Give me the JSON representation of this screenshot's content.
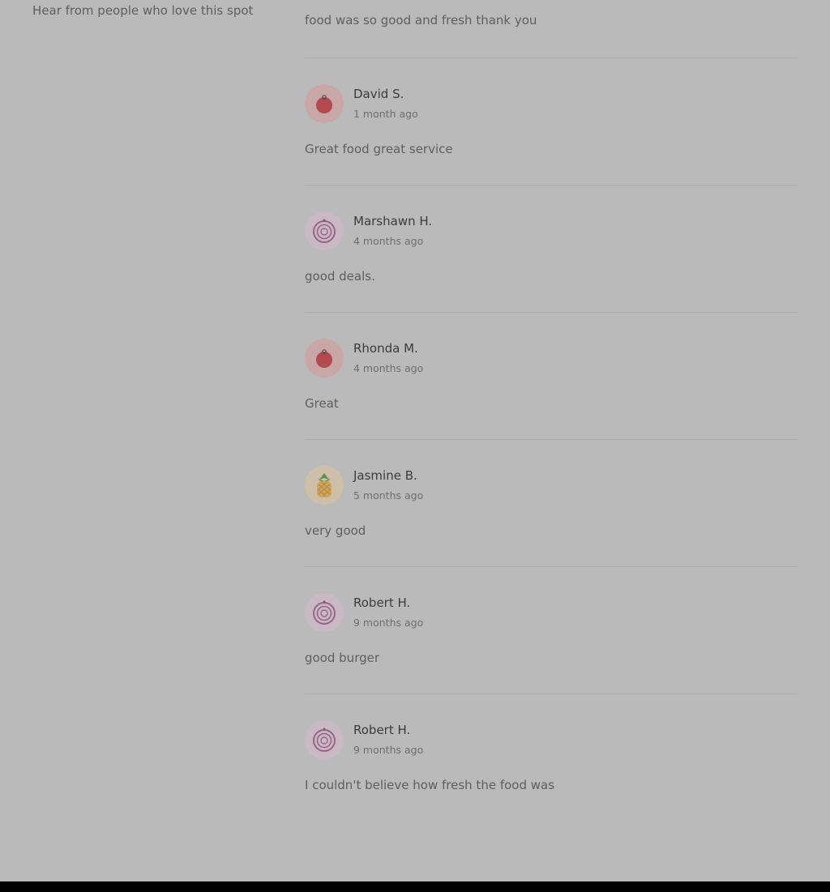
{
  "sidebar": {
    "subtitle": "Hear from people who love this spot"
  },
  "first_review": {
    "text": "food was so good and fresh thank you"
  },
  "reviews": [
    {
      "name": "David S.",
      "date": "1 month ago",
      "text": "Great food great service",
      "avatar": "tomato-icon",
      "avatar_bg": "#c9a7a7"
    },
    {
      "name": "Marshawn H.",
      "date": "4 months ago",
      "text": "good deals.",
      "avatar": "onion-icon",
      "avatar_bg": "#c8b9c4"
    },
    {
      "name": "Rhonda M.",
      "date": "4 months ago",
      "text": "Great",
      "avatar": "tomato-icon",
      "avatar_bg": "#c9a7a7"
    },
    {
      "name": "Jasmine B.",
      "date": "5 months ago",
      "text": "very good",
      "avatar": "pineapple-icon",
      "avatar_bg": "#cdbfa8"
    },
    {
      "name": "Robert H.",
      "date": "9 months ago",
      "text": "good burger",
      "avatar": "onion-icon",
      "avatar_bg": "#c8b9c4"
    },
    {
      "name": "Robert H.",
      "date": "9 months ago",
      "text": "I couldn't believe how fresh the food was",
      "avatar": "onion-icon",
      "avatar_bg": "#c8b9c4"
    }
  ],
  "colors": {
    "page_bg": "#bababa",
    "divider": "#a9a9a9",
    "name_text": "#3b3b3b",
    "body_text": "#5e5e5e",
    "footer": "#000000"
  }
}
